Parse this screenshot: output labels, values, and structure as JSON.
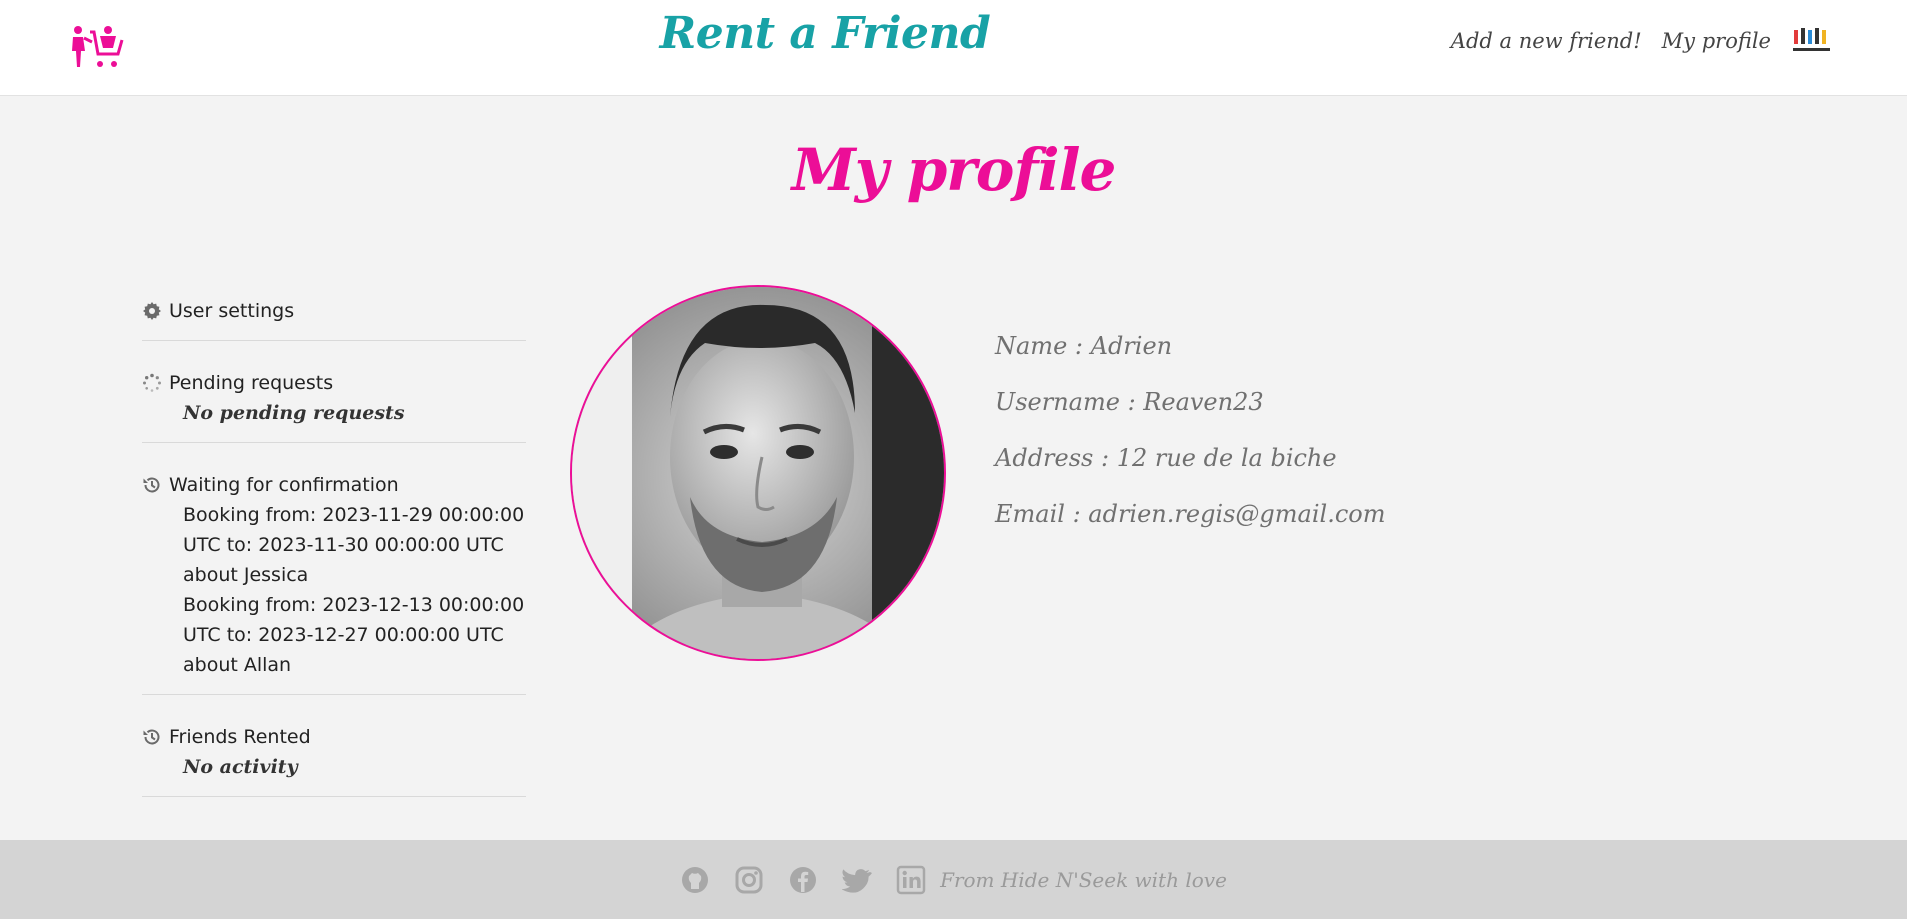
{
  "header": {
    "brand": "Rent a Friend",
    "nav": {
      "add_friend": "Add a new friend!",
      "my_profile": "My profile"
    },
    "logo_icon": "shopping-cart-person-icon",
    "friends_logo_icon": "friends-logo-icon"
  },
  "page": {
    "title": "My profile"
  },
  "sidebar": {
    "user_settings": {
      "label": "User settings",
      "icon": "gear-icon"
    },
    "pending": {
      "label": "Pending requests",
      "icon": "spinner-icon",
      "note": "No pending requests"
    },
    "waiting": {
      "label": "Waiting for confirmation",
      "icon": "history-icon",
      "bookings": [
        "Booking from: 2023-11-29 00:00:00 UTC to: 2023-11-30 00:00:00 UTC about Jessica",
        "Booking from: 2023-12-13 00:00:00 UTC to: 2023-12-27 00:00:00 UTC about Allan"
      ]
    },
    "rented": {
      "label": "Friends Rented",
      "icon": "history-icon",
      "note": "No activity"
    }
  },
  "profile": {
    "name": "Name : Adrien",
    "username": "Username : Reaven23",
    "address": "Address : 12 rue de la biche",
    "email": "Email : adrien.regis@gmail.com"
  },
  "footer": {
    "icons": [
      "github-icon",
      "instagram-icon",
      "facebook-icon",
      "twitter-icon",
      "linkedin-icon"
    ],
    "text": "From Hide N'Seek with love"
  },
  "colors": {
    "accent_pink": "#ec0e97",
    "brand_teal": "#18a2a6",
    "background": "#f3f3f3",
    "footer_bg": "#d4d4d4"
  }
}
